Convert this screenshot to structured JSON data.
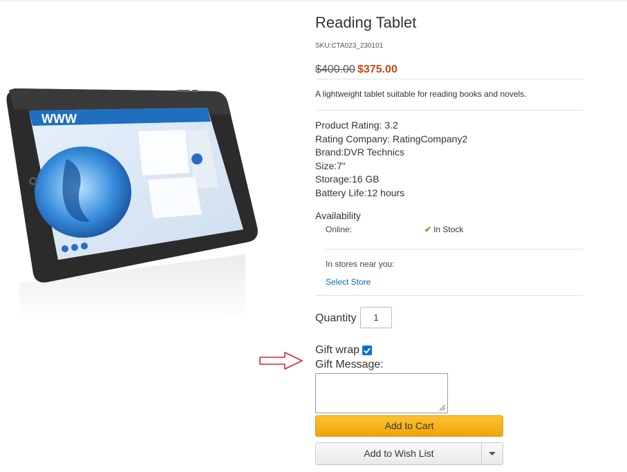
{
  "product": {
    "title": "Reading Tablet",
    "sku": "SKU:CTA023_230101",
    "price_old": "$400.00",
    "price_new": "$375.00",
    "description": "A lightweight tablet suitable for reading books and novels.",
    "image_alt": "tablet-product-image",
    "specs": [
      "Product Rating: 3.2",
      "Rating Company: RatingCompany2",
      "Brand:DVR Technics",
      "Size:7\"",
      "Storage:16 GB",
      "Battery Life:12 hours"
    ]
  },
  "availability": {
    "label": "Availability",
    "online_label": "Online:",
    "online_status": "In Stock",
    "stores_label": "In stores near you:",
    "select_store": "Select Store"
  },
  "purchase": {
    "quantity_label": "Quantity",
    "quantity_value": "1",
    "gift_wrap_label": "Gift wrap",
    "gift_wrap_checked": true,
    "gift_message_label": "Gift Message:",
    "gift_message_value": "",
    "add_to_cart": "Add to Cart",
    "add_to_wish_list": "Add to Wish List"
  },
  "colors": {
    "sale_price": "#c8470b",
    "link": "#0a6bb3",
    "in_stock_check": "#5aa02c",
    "cart_button": "#f5b01b",
    "annotation_arrow": "#d9262b"
  },
  "icons": {
    "in_stock": "check-icon",
    "wishlist_toggle": "chevron-down-icon",
    "annotation": "arrow-right-icon"
  }
}
